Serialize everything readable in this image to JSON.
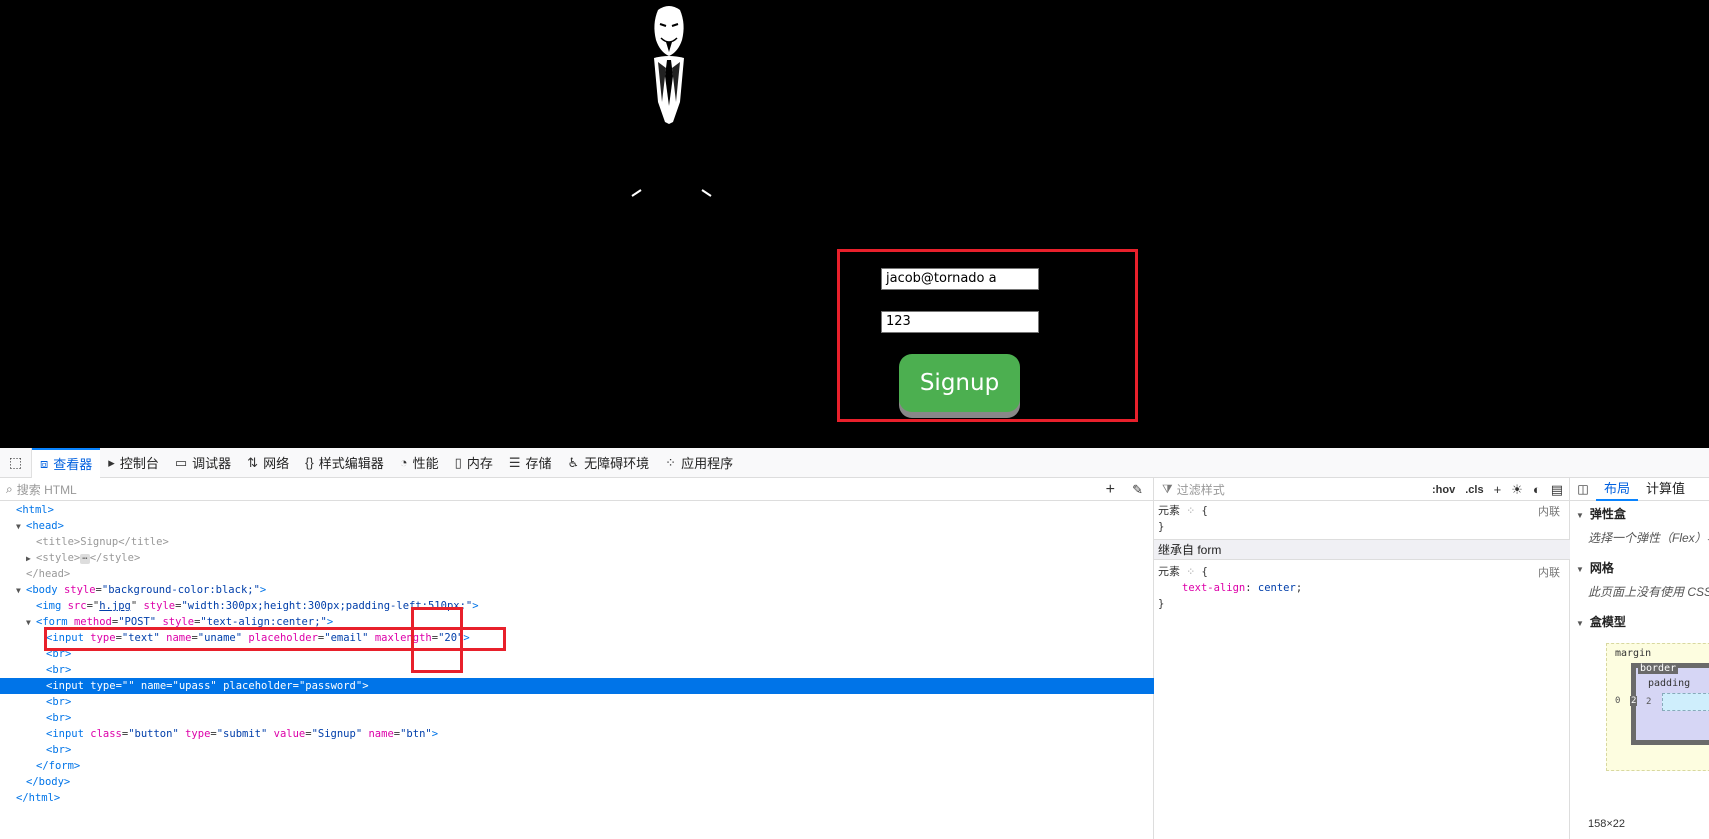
{
  "page": {
    "email_value": "jacob@tornado a",
    "password_value": "123",
    "signup_label": "Signup"
  },
  "devtools": {
    "tabs": [
      {
        "label": "查看器",
        "icon": "inspector-icon"
      },
      {
        "label": "控制台",
        "icon": "console-icon"
      },
      {
        "label": "调试器",
        "icon": "debugger-icon"
      },
      {
        "label": "网络",
        "icon": "network-icon"
      },
      {
        "label": "样式编辑器",
        "icon": "style-editor-icon"
      },
      {
        "label": "性能",
        "icon": "performance-icon"
      },
      {
        "label": "内存",
        "icon": "memory-icon"
      },
      {
        "label": "存储",
        "icon": "storage-icon"
      },
      {
        "label": "无障碍环境",
        "icon": "accessibility-icon"
      },
      {
        "label": "应用程序",
        "icon": "application-icon"
      }
    ],
    "markup": {
      "search_placeholder": "搜索 HTML",
      "lines": {
        "l01": "<html>",
        "l02": "<head>",
        "l03_open": "<title>",
        "l03_text": "Signup",
        "l03_close": "</title>",
        "l04_open": "<style>",
        "l04_close": "</style>",
        "l05": "</head>",
        "l06_open": "<body ",
        "l06_attr": "style",
        "l06_val": "\"background-color:black;\"",
        "l06_end": ">",
        "l07_open": "<img ",
        "l07_a1": "src",
        "l07_v1": "h.jpg",
        "l07_a2": "style",
        "l07_v2": "\"width:300px;height:300px;padding-left:510px;\"",
        "l07_end": ">",
        "l08_open": "<form ",
        "l08_a1": "method",
        "l08_v1": "\"POST\"",
        "l08_a2": "style",
        "l08_v2": "\"text-align:center;\"",
        "l08_end": ">",
        "l09_open": "<input ",
        "l09_a1": "type",
        "l09_v1": "\"text\"",
        "l09_a2": "name",
        "l09_v2": "\"uname\"",
        "l09_a3": "placeholder",
        "l09_v3": "\"email\"",
        "l09_a4": "maxlength",
        "l09_v4": "\"20\"",
        "l09_end": ">",
        "br": "<br>",
        "l12_open": "<input ",
        "l12_a1": "type",
        "l12_v1": "\"\"",
        "l12_a2": "name",
        "l12_v2": "\"upass\"",
        "l12_a3": "placeholder",
        "l12_v3": "\"password\"",
        "l12_end": ">",
        "l15_open": "<input ",
        "l15_a1": "class",
        "l15_v1": "\"button\"",
        "l15_a2": "type",
        "l15_v2": "\"submit\"",
        "l15_a3": "value",
        "l15_v3": "\"Signup\"",
        "l15_a4": "name",
        "l15_v4": "\"btn\"",
        "l15_end": ">",
        "l17": "</form>",
        "l18": "</body>",
        "l19": "</html>"
      }
    },
    "rules": {
      "filter_placeholder": "过滤样式",
      "hov": ":hov",
      "cls": ".cls",
      "element_selector": "元素",
      "brace_open": "{",
      "brace_close": "}",
      "source_inline": "内联",
      "inherited_from": "继承自 form",
      "inherited_prop": "text-align",
      "inherited_value": "center"
    },
    "layout": {
      "tab_layout": "布局",
      "tab_computed": "计算值",
      "flexbox_title": "弹性盒",
      "flexbox_hint": "选择一个弹性（Flex）容器",
      "grid_title": "网格",
      "grid_hint": "此页面上没有使用 CSS 网格",
      "boxmodel_title": "盒模型",
      "margin_label": "margin",
      "margin_left": "0",
      "border_label": "border",
      "border_left": "2",
      "padding_label": "padding",
      "padding_left": "2",
      "dimensions": "158×22"
    }
  },
  "colors": {
    "signup_bg": "#4caf50",
    "highlight_red": "#e8202b",
    "selection_blue": "#0074e8",
    "active_tab_blue": "#0060df"
  }
}
